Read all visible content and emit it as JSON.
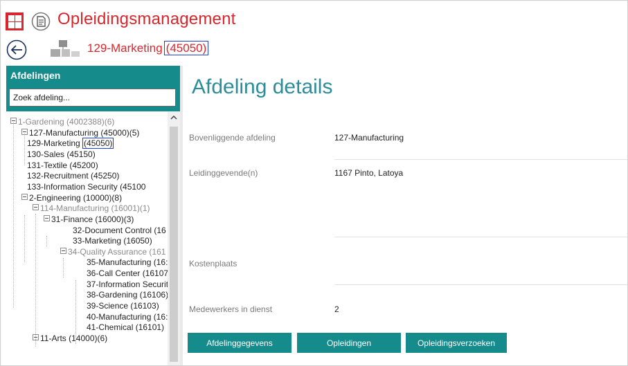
{
  "app": {
    "title": "Opleidingsmanagement",
    "accent": "#d9262c",
    "teal": "#168b8c"
  },
  "breadcrumb": {
    "name": "129-Marketing",
    "code": "(45050)"
  },
  "sidebar": {
    "title": "Afdelingen",
    "search_value": "Zoek afdeling...",
    "tree": [
      {
        "label": "1-Gardening (4002388)(6)",
        "muted": true,
        "toggle": true
      },
      {
        "label": "127-Manufacturing (45000)(5)",
        "toggle": true
      },
      {
        "label": "129-Marketing ",
        "code": "(45050)"
      },
      {
        "label": "130-Sales (45150)"
      },
      {
        "label": "131-Textile (45200)"
      },
      {
        "label": "132-Recruitment (45250)"
      },
      {
        "label": "133-Information Security (45100"
      },
      {
        "label": "2-Engineering (10000)(8)",
        "toggle": true
      },
      {
        "label": "114-Manufacturing (16001)(1)",
        "muted": true,
        "toggle": true
      },
      {
        "label": "31-Finance (16000)(3)",
        "toggle": true
      },
      {
        "label": "32-Document Control (16"
      },
      {
        "label": "33-Marketing (16050)"
      },
      {
        "label": "34-Quality Assurance (161",
        "muted": true,
        "toggle": true
      },
      {
        "label": "35-Manufacturing (16:"
      },
      {
        "label": "36-Call Center (16107)"
      },
      {
        "label": "37-Information Securit"
      },
      {
        "label": "38-Gardening (16106)"
      },
      {
        "label": "39-Science (16103)"
      },
      {
        "label": "40-Manufacturing (16:"
      },
      {
        "label": "41-Chemical (16101)"
      },
      {
        "label": "11-Arts (14000)(6)",
        "toggle": true
      }
    ]
  },
  "main": {
    "title": "Afdeling details",
    "fields": [
      {
        "label": "Bovenliggende afdeling",
        "value": "127-Manufacturing"
      },
      {
        "label": "Leidinggevende(n)",
        "value": "1167 Pinto, Latoya"
      },
      {
        "label": "Kostenplaats",
        "value": ""
      },
      {
        "label": "Medewerkers in dienst",
        "value": "2"
      }
    ],
    "buttons": [
      "Afdelinggegevens",
      "Opleidingen",
      "Opleidingsverzoeken"
    ]
  }
}
